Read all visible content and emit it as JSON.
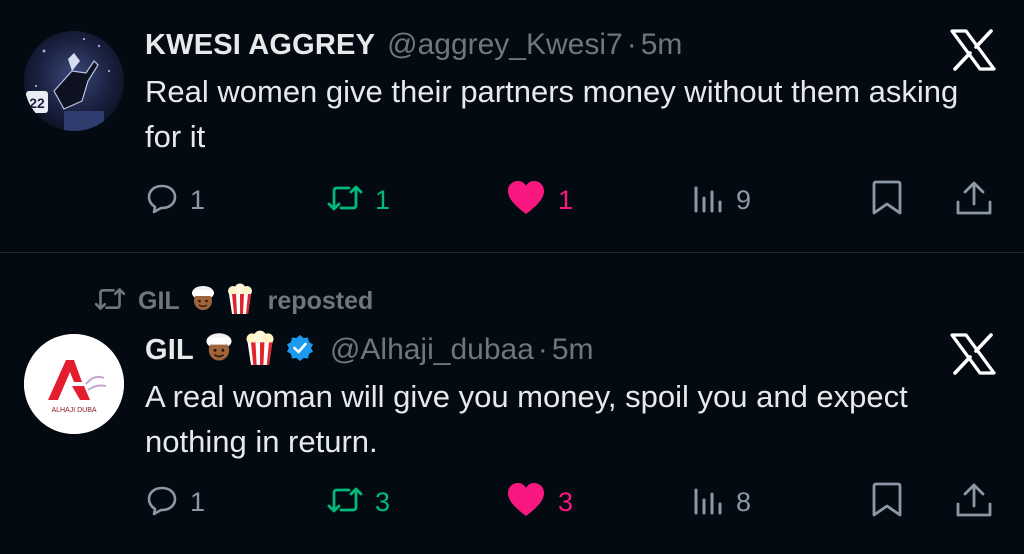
{
  "tweets": [
    {
      "name": "KWESI AGGREY",
      "handle": "@aggrey_Kwesi7",
      "separator": "·",
      "time": "5m",
      "text": "Real women give their partners money without them asking for it",
      "avatar_text": "22",
      "stats": {
        "replies": "1",
        "retweets": "1",
        "likes": "1",
        "views": "9"
      }
    },
    {
      "repost_by": "GIL",
      "repost_label": "reposted",
      "name": "GIL",
      "verified": true,
      "handle": "@Alhaji_dubaa",
      "separator": "·",
      "time": "5m",
      "text": "A real woman will give you money, spoil you and expect nothing in return.",
      "avatar_brand": "ALHAJI DUBA",
      "emojis": [
        "person-with-turban-emoji",
        "popcorn-emoji"
      ],
      "stats": {
        "replies": "1",
        "retweets": "3",
        "likes": "3",
        "views": "8"
      }
    }
  ],
  "colors": {
    "background": "#040a12",
    "text": "#e7e9ea",
    "muted": "#71767b",
    "retweet": "#00ba7c",
    "like": "#f91880",
    "verified": "#1d9bf0"
  },
  "icons": [
    "reply-icon",
    "retweet-icon",
    "heart-icon",
    "views-icon",
    "bookmark-icon",
    "share-icon",
    "x-logo-icon",
    "verified-badge-icon"
  ]
}
